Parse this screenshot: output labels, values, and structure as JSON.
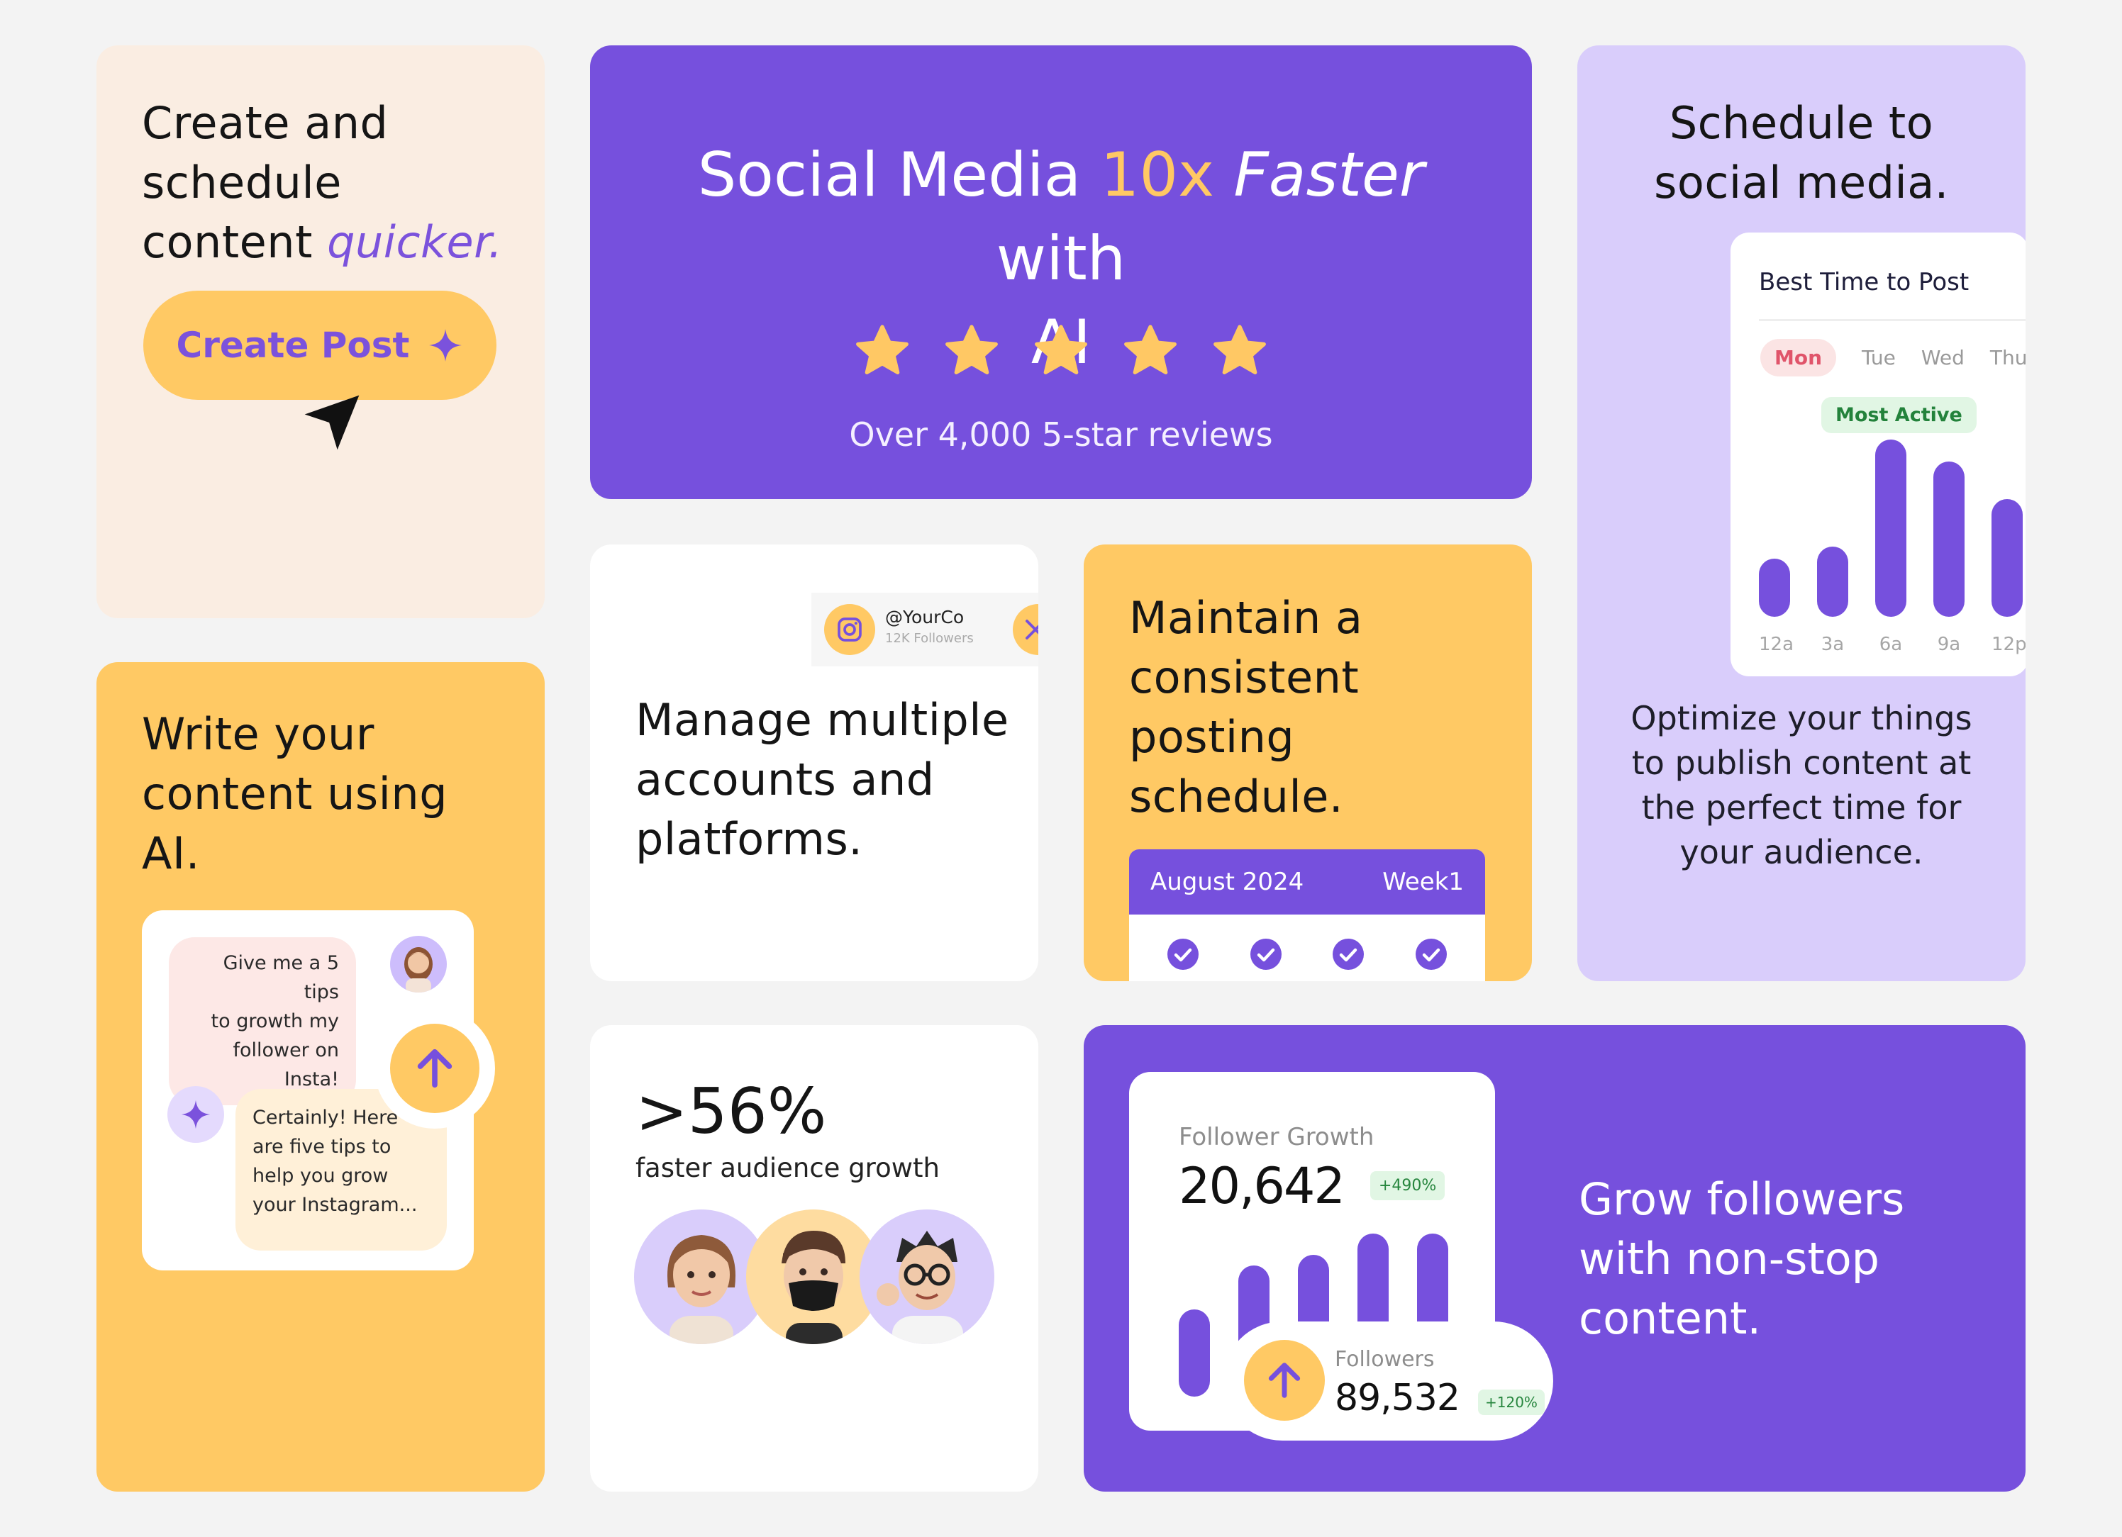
{
  "card_create": {
    "line1": "Create and",
    "line2": "schedule",
    "line3": "content",
    "highlight": "quicker.",
    "button_label": "Create Post"
  },
  "hero": {
    "title_part1": "Social Media",
    "title_accent": "10x",
    "title_italic": "Faster",
    "title_part2": "with",
    "title_line2": "AI",
    "rating": 5,
    "reviews": "Over 4,000 5-star reviews"
  },
  "schedule": {
    "title_line1": "Schedule to",
    "title_line2": "social media.",
    "panel_title": "Best Time to Post",
    "days": [
      "Mon",
      "Tue",
      "Wed",
      "Thu"
    ],
    "active_day": "Mon",
    "badge": "Most Active",
    "bar_labels": [
      "12a",
      "3a",
      "6a",
      "9a",
      "12p"
    ],
    "bar_values": [
      0.2,
      0.28,
      1.0,
      0.85,
      0.6
    ],
    "description": "Optimize your things to publish content at the perfect time for your audience.",
    "desc_lines": [
      "Optimize your things",
      "to publish content at",
      "the perfect time for",
      "your audience."
    ]
  },
  "write_ai": {
    "title_line1": "Write your",
    "title_line2": "content using",
    "title_line3": "AI.",
    "user_msg_lines": [
      "Give me a 5 tips",
      "to growth my",
      "follower on Insta!"
    ],
    "ai_msg_lines": [
      "Certainly! Here",
      "are five tips to",
      "help you grow",
      "your Instagram..."
    ]
  },
  "accounts": {
    "handle": "@YourCo",
    "followers": "12K Followers",
    "title_line1": "Manage multiple",
    "title_line2": "accounts and",
    "title_line3": "platforms."
  },
  "consistent": {
    "title_line1": "Maintain a",
    "title_line2": "consistent",
    "title_line3": "posting",
    "title_line4": "schedule.",
    "month": "August 2024",
    "week": "Week1"
  },
  "growth_stat": {
    "value": ">56%",
    "label": "faster audience growth"
  },
  "followers": {
    "panel_title": "Follower Growth",
    "value": "20,642",
    "change": "+490%",
    "bar_values": [
      0.55,
      0.7,
      0.8,
      1.0,
      1.0
    ],
    "sub_label": "Followers",
    "sub_value": "89,532",
    "sub_change": "+120%",
    "headline_line1": "Grow followers",
    "headline_line2": "with non-stop",
    "headline_line3": "content."
  },
  "colors": {
    "purple": "#7650dd",
    "yellow": "#ffc964",
    "lavender": "#d9cdfb",
    "peach": "#faede2"
  }
}
